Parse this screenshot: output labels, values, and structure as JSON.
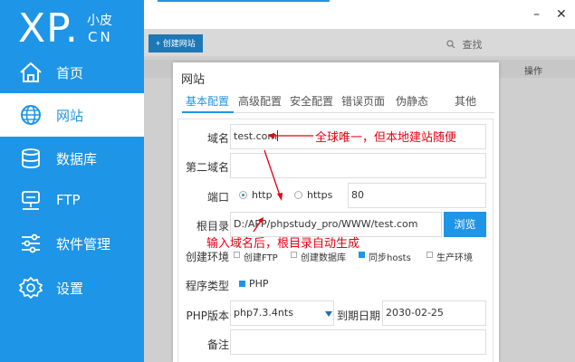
{
  "logo": {
    "xp": "XP.",
    "xiaopi": "小皮",
    "cn": "CN"
  },
  "sidebar": {
    "items": [
      {
        "label": "首页",
        "icon": "home-icon"
      },
      {
        "label": "网站",
        "icon": "globe-icon"
      },
      {
        "label": "数据库",
        "icon": "database-icon"
      },
      {
        "label": "FTP",
        "icon": "ftp-server-icon"
      },
      {
        "label": "软件管理",
        "icon": "sliders-icon"
      },
      {
        "label": "设置",
        "icon": "gear-icon"
      }
    ],
    "active_index": 1
  },
  "window": {
    "minimize": "–",
    "close": "✕"
  },
  "toolbar": {
    "create_label": "创建网站",
    "create_icon": "+",
    "search_label": "查找"
  },
  "table": {
    "op_header": "操作"
  },
  "dialog": {
    "title": "网站",
    "tabs": [
      "基本配置",
      "高级配置",
      "安全配置",
      "错误页面",
      "伪静态",
      "其他"
    ],
    "active_tab": 0,
    "form": {
      "domain_label": "域名",
      "domain_value": "test.com",
      "second_domain_label": "第二域名",
      "second_domain_value": "",
      "port_label": "端口",
      "protocols": [
        "http",
        "https"
      ],
      "selected_protocol": "http",
      "port_value": "80",
      "root_label": "根目录",
      "root_value": "D:/APP/phpstudy_pro/WWW/test.com",
      "browse_label": "浏览",
      "env_label": "创建环境",
      "env_options": [
        {
          "label": "创建FTP",
          "checked": false
        },
        {
          "label": "创建数据库",
          "checked": false
        },
        {
          "label": "同步hosts",
          "checked": true
        },
        {
          "label": "生产环境",
          "checked": false
        }
      ],
      "program_label": "程序类型",
      "program_option": {
        "label": "PHP",
        "checked": true
      },
      "php_label": "PHP版本",
      "php_value": "php7.3.4nts",
      "expire_label": "到期日期",
      "expire_value": "2030-02-25",
      "note_label": "备注",
      "note_value": ""
    }
  },
  "annotations": {
    "top": "全球唯一，但本地建站随便",
    "bottom": "输入域名后，根目录自动生成",
    "color": "#e60012"
  },
  "colors": {
    "brand": "#1e95e6"
  }
}
